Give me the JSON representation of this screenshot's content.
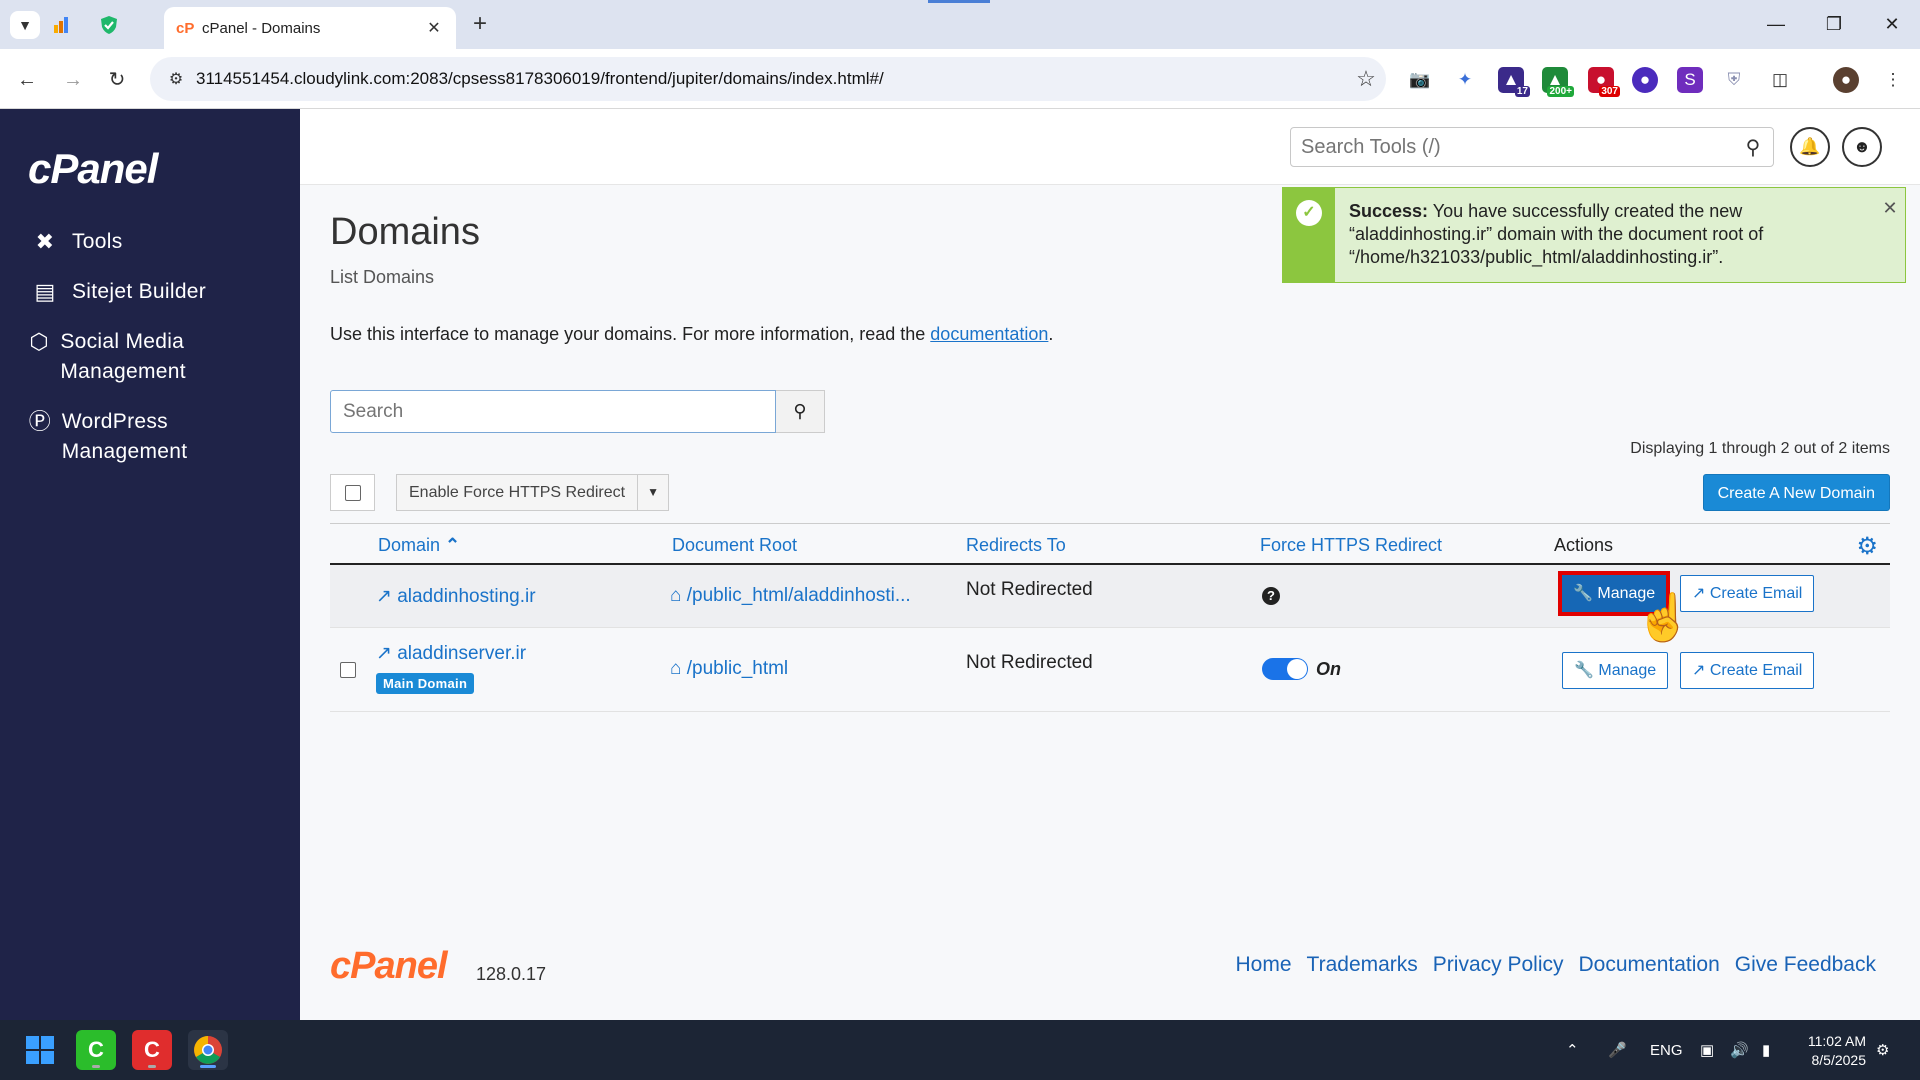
{
  "browser": {
    "tab_title": "cPanel - Domains",
    "url": "3114551454.cloudylink.com:2083/cpsess8178306019/frontend/jupiter/domains/index.html#/",
    "ext_badges": [
      "17",
      "200+",
      "307"
    ]
  },
  "sidebar": {
    "logo": "cPanel",
    "items": [
      {
        "label": "Tools",
        "icon": "tools-icon"
      },
      {
        "label": "Sitejet Builder",
        "icon": "sitejet-icon"
      },
      {
        "label": "Social Media Management",
        "icon": "social-media-icon"
      },
      {
        "label": "WordPress Management",
        "icon": "wordpress-icon"
      }
    ]
  },
  "header": {
    "search_placeholder": "Search Tools (/)"
  },
  "alert": {
    "bold": "Success:",
    "text": "You have successfully created the new “aladdinhosting.ir” domain with the document root of “/home/h321033/public_html/aladdinhosting.ir”."
  },
  "page": {
    "title": "Domains",
    "subtitle": "List Domains",
    "desc_before": "Use this interface to manage your domains. For more information, read the ",
    "desc_link": "documentation",
    "desc_after": ".",
    "search_placeholder": "Search",
    "displaying": "Displaying 1 through 2 out of 2 items",
    "bulk_action": "Enable Force HTTPS Redirect",
    "create_button": "Create A New Domain"
  },
  "table": {
    "columns": [
      "Domain",
      "Document Root",
      "Redirects To",
      "Force HTTPS Redirect",
      "Actions"
    ],
    "sort_indicator": "^",
    "rows": [
      {
        "domain": "aladdinhosting.ir",
        "doc_root": "/public_html/aladdinhosti...",
        "redirect": "Not Redirected",
        "https": "",
        "manage": "Manage",
        "email": "Create Email"
      },
      {
        "domain": "aladdinserver.ir",
        "badge": "Main Domain",
        "doc_root": "/public_html",
        "redirect": "Not Redirected",
        "https": "On",
        "manage": "Manage",
        "email": "Create Email"
      }
    ]
  },
  "footer": {
    "logo": "cPanel",
    "version": "128.0.17",
    "links": [
      "Home",
      "Trademarks",
      "Privacy Policy",
      "Documentation",
      "Give Feedback"
    ]
  },
  "taskbar": {
    "lang": "ENG",
    "time": "11:02 AM",
    "date": "8/5/2025"
  },
  "colors": {
    "sidebar_bg": "#1f2348",
    "accent": "#1a73c9",
    "brand_orange": "#ff6c2c",
    "success": "#8cc63f",
    "highlight_red": "#e00000"
  }
}
